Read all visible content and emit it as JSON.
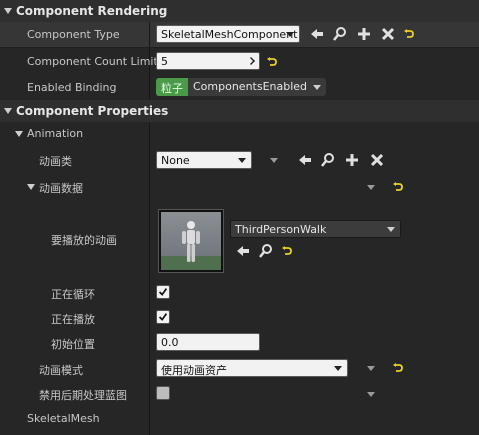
{
  "categories": {
    "rendering": "Component Rendering",
    "properties": "Component Properties"
  },
  "rendering": {
    "component_type_label": "Component Type",
    "component_type_value": "SkeletalMeshComponent",
    "count_limit_label": "Component Count Limit",
    "count_limit_value": "5",
    "enabled_binding_label": "Enabled Binding",
    "enabled_binding_tag": "粒子",
    "enabled_binding_value": "ComponentsEnabled"
  },
  "animation": {
    "group_label": "Animation",
    "anim_class_label": "动画类",
    "anim_class_value": "None",
    "anim_data_label": "动画数据",
    "anim_to_play_label": "要播放的动画",
    "anim_to_play_value": "ThirdPersonWalk",
    "looping_label": "正在循环",
    "playing_label": "正在播放",
    "initial_pos_label": "初始位置",
    "initial_pos_value": "0.0",
    "anim_mode_label": "动画模式",
    "anim_mode_value": "使用动画资产",
    "disable_post_label": "禁用后期处理蓝图",
    "skeletal_mesh_label": "SkeletalMesh"
  },
  "colors": {
    "tag_green": "#4a9a4a",
    "reset_yellow": "#e8d12a"
  }
}
